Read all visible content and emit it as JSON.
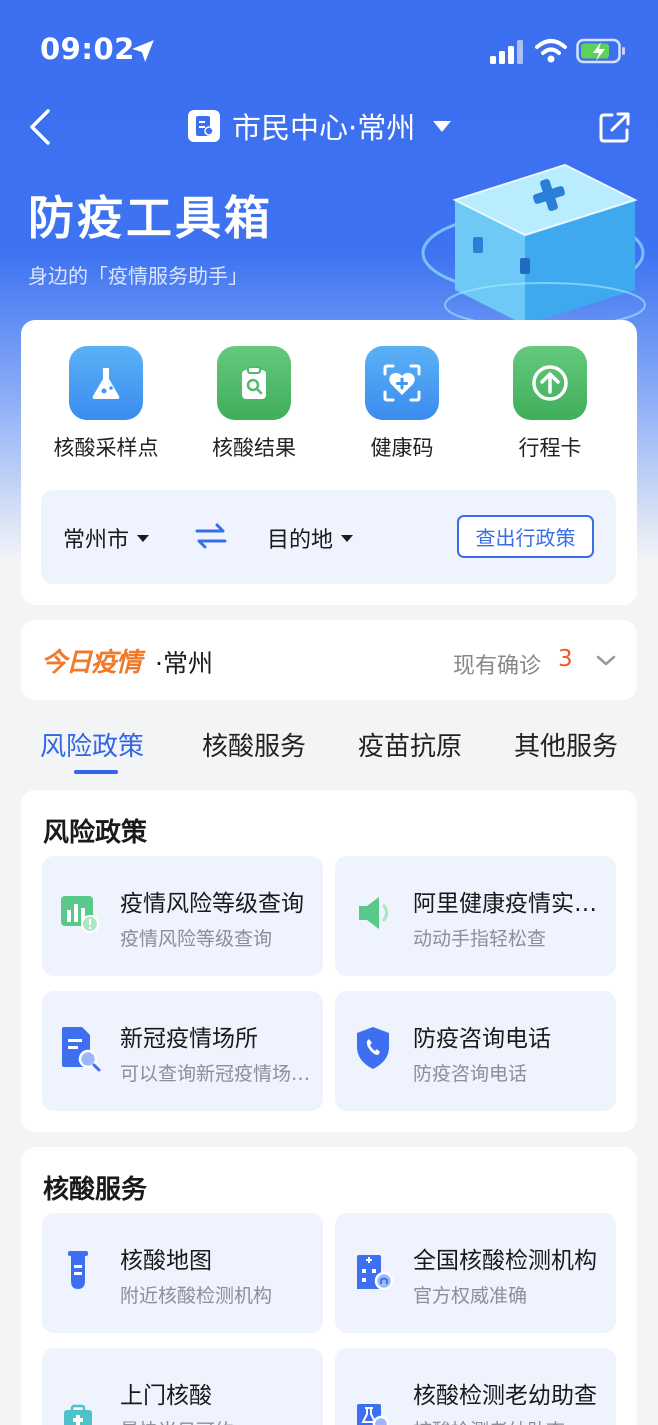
{
  "status_bar": {
    "time": "09:02"
  },
  "nav": {
    "title": "市民中心·常州"
  },
  "hero": {
    "title": "防疫工具箱",
    "subtitle": "身边的「疫情服务助手」"
  },
  "tools": [
    {
      "label": "核酸采样点",
      "icon": "flask-icon",
      "color": "#3f97f0"
    },
    {
      "label": "核酸结果",
      "icon": "clipboard-search-icon",
      "color": "#4dbb6d"
    },
    {
      "label": "健康码",
      "icon": "heart-scan-icon",
      "color": "#3f97f0"
    },
    {
      "label": "行程卡",
      "icon": "arrow-up-circle-icon",
      "color": "#4dbb6d"
    }
  ],
  "travel_policy": {
    "origin": "常州市",
    "destination": "目的地",
    "button": "查出行政策"
  },
  "today": {
    "logo": "今日疫情",
    "city": "·常州",
    "count_label": "现有确诊",
    "count": "3"
  },
  "tabs": [
    "风险政策",
    "核酸服务",
    "疫苗抗原",
    "其他服务"
  ],
  "sections": [
    {
      "title": "风险政策",
      "items": [
        {
          "title": "疫情风险等级查询",
          "subtitle": "疫情风险等级查询",
          "icon": "risk-chart-icon"
        },
        {
          "title": "阿里健康疫情实时追踪",
          "subtitle": "动动手指轻松查",
          "icon": "speaker-icon"
        },
        {
          "title": "新冠疫情场所",
          "subtitle": "可以查询新冠疫情场所信息",
          "icon": "doc-search-icon"
        },
        {
          "title": "防疫咨询电话",
          "subtitle": "防疫咨询电话",
          "icon": "shield-phone-icon"
        }
      ]
    },
    {
      "title": "核酸服务",
      "items": [
        {
          "title": "核酸地图",
          "subtitle": "附近核酸检测机构",
          "icon": "test-tube-icon"
        },
        {
          "title": "全国核酸检测机构",
          "subtitle": "官方权威准确",
          "icon": "hospital-icon"
        },
        {
          "title": "上门核酸",
          "subtitle": "最快当日可约",
          "icon": "medical-kit-icon"
        },
        {
          "title": "核酸检测老幼助查",
          "subtitle": "核酸检测老幼助查",
          "icon": "flask-doc-icon"
        }
      ]
    }
  ]
}
